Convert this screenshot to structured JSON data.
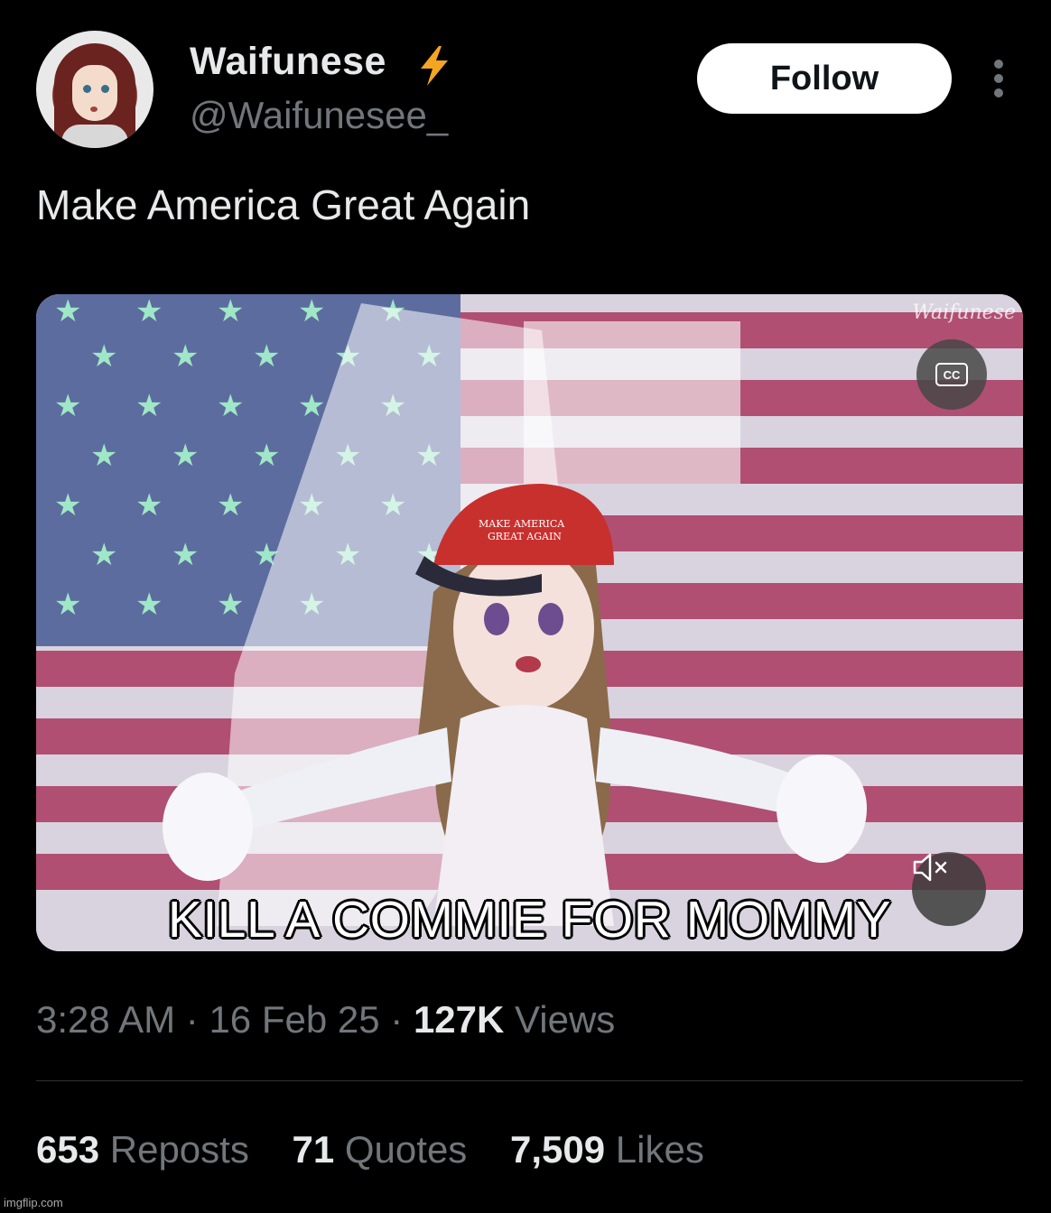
{
  "author": {
    "display_name": "Waifunese",
    "handle": "@Waifunesee_",
    "badge_icon": "lightning-bolt-icon",
    "avatar_icon": "anime-avatar-icon"
  },
  "header": {
    "follow_label": "Follow",
    "more_icon": "more-vertical-icon"
  },
  "tweet": {
    "text": "Make America Great Again"
  },
  "media": {
    "watermark": "Waifunese",
    "cc_label": "CC",
    "mute_icon": "speaker-muted-icon",
    "hat_text_line1": "MAKE AMERICA",
    "hat_text_line2": "GREAT AGAIN",
    "caption": "KILL A COMMIE FOR MOMMY"
  },
  "meta": {
    "time": "3:28 AM",
    "separator": "·",
    "date": "16 Feb 25",
    "views_count": "127K",
    "views_label": "Views"
  },
  "stats": {
    "reposts_count": "653",
    "reposts_label": "Reposts",
    "quotes_count": "71",
    "quotes_label": "Quotes",
    "likes_count": "7,509",
    "likes_label": "Likes"
  },
  "footer": {
    "site_watermark": "imgflip.com"
  },
  "colors": {
    "background": "#000000",
    "text_primary": "#e7e9ea",
    "text_secondary": "#71767b",
    "bolt": "#f4a522",
    "follow_bg": "#ffffff",
    "divider": "#2f3336"
  }
}
